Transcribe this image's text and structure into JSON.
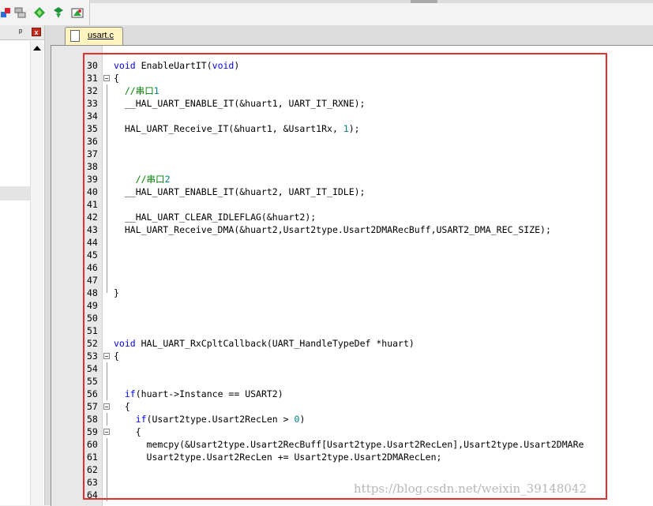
{
  "toolbar": {
    "icons": [
      "build-icon",
      "rebuild-icon",
      "download-icon",
      "debug-icon",
      "options-icon"
    ]
  },
  "left_pane": {
    "pin": "ᵖ",
    "close": "x"
  },
  "editor": {
    "tab": "usart.c",
    "lines": [
      {
        "n": "30",
        "t": "void EnableUartIT(void)"
      },
      {
        "n": "31",
        "t": "{"
      },
      {
        "n": "32",
        "t": "  //串口1"
      },
      {
        "n": "33",
        "t": "  __HAL_UART_ENABLE_IT(&huart1, UART_IT_RXNE);"
      },
      {
        "n": "34",
        "t": ""
      },
      {
        "n": "35",
        "t": "  HAL_UART_Receive_IT(&huart1, &Usart1Rx, 1);"
      },
      {
        "n": "36",
        "t": ""
      },
      {
        "n": "37",
        "t": ""
      },
      {
        "n": "38",
        "t": ""
      },
      {
        "n": "39",
        "t": "    //串口2"
      },
      {
        "n": "40",
        "t": "  __HAL_UART_ENABLE_IT(&huart2, UART_IT_IDLE);"
      },
      {
        "n": "41",
        "t": ""
      },
      {
        "n": "42",
        "t": "  __HAL_UART_CLEAR_IDLEFLAG(&huart2);"
      },
      {
        "n": "43",
        "t": "  HAL_UART_Receive_DMA(&huart2,Usart2type.Usart2DMARecBuff,USART2_DMA_REC_SIZE);"
      },
      {
        "n": "44",
        "t": ""
      },
      {
        "n": "45",
        "t": ""
      },
      {
        "n": "46",
        "t": ""
      },
      {
        "n": "47",
        "t": ""
      },
      {
        "n": "48",
        "t": "}"
      },
      {
        "n": "49",
        "t": ""
      },
      {
        "n": "50",
        "t": ""
      },
      {
        "n": "51",
        "t": ""
      },
      {
        "n": "52",
        "t": "void HAL_UART_RxCpltCallback(UART_HandleTypeDef *huart)"
      },
      {
        "n": "53",
        "t": "{"
      },
      {
        "n": "54",
        "t": ""
      },
      {
        "n": "55",
        "t": ""
      },
      {
        "n": "56",
        "t": "  if(huart->Instance == USART2)"
      },
      {
        "n": "57",
        "t": "  {"
      },
      {
        "n": "58",
        "t": "    if(Usart2type.Usart2RecLen > 0)"
      },
      {
        "n": "59",
        "t": "    {"
      },
      {
        "n": "60",
        "t": "      memcpy(&Usart2type.Usart2RecBuff[Usart2type.Usart2RecLen],Usart2type.Usart2DMARe"
      },
      {
        "n": "61",
        "t": "      Usart2type.Usart2RecLen += Usart2type.Usart2DMARecLen;"
      },
      {
        "n": "62",
        "t": ""
      },
      {
        "n": "63",
        "t": ""
      },
      {
        "n": "64",
        "t": ""
      }
    ]
  },
  "watermark": "https://blog.csdn.net/weixin_39148042"
}
